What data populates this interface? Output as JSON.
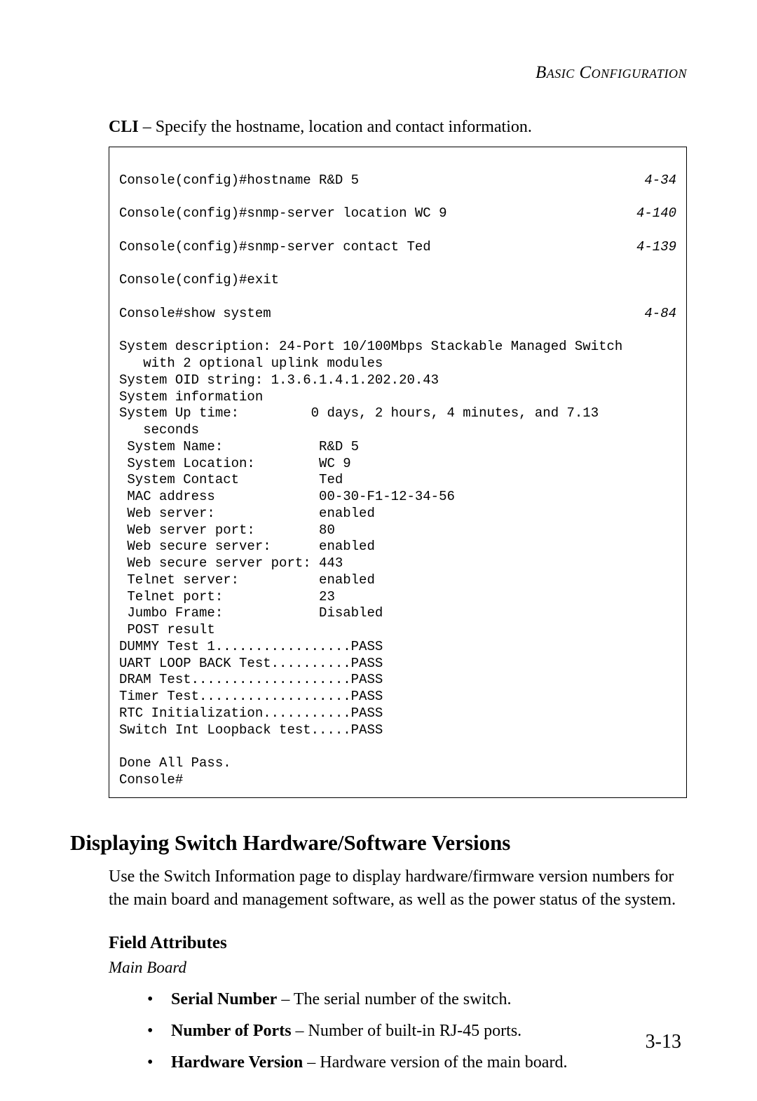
{
  "running_head": "Basic Configuration",
  "intro": {
    "label": "CLI",
    "text": " – Specify the hostname, location and contact information."
  },
  "cli": {
    "rows_with_ref": [
      {
        "cmd": "Console(config)#hostname R&D 5",
        "ref": "4-34"
      },
      {
        "cmd": "Console(config)#snmp-server location WC 9",
        "ref": "4-140"
      },
      {
        "cmd": "Console(config)#snmp-server contact Ted",
        "ref": "4-139"
      },
      {
        "cmd": "Console(config)#exit",
        "ref": ""
      },
      {
        "cmd": "Console#show system",
        "ref": "4-84"
      }
    ],
    "body": "System description: 24-Port 10/100Mbps Stackable Managed Switch \n   with 2 optional uplink modules\nSystem OID string: 1.3.6.1.4.1.202.20.43\nSystem information\nSystem Up time:         0 days, 2 hours, 4 minutes, and 7.13 \n   seconds\n System Name:            R&D 5\n System Location:        WC 9\n System Contact          Ted\n MAC address             00-30-F1-12-34-56\n Web server:             enabled\n Web server port:        80\n Web secure server:      enabled\n Web secure server port: 443\n Telnet server:          enabled\n Telnet port:            23\n Jumbo Frame:            Disabled\n POST result\nDUMMY Test 1.................PASS\nUART LOOP BACK Test..........PASS\nDRAM Test....................PASS\nTimer Test...................PASS\nRTC Initialization...........PASS\nSwitch Int Loopback test.....PASS\n\nDone All Pass.\nConsole#"
  },
  "section_heading": "Displaying Switch Hardware/Software Versions",
  "section_para": "Use the Switch Information page to display hardware/firmware version numbers for the main board and management software, as well as the power status of the system.",
  "field_attributes_heading": "Field Attributes",
  "main_board_label": "Main Board",
  "attrs": [
    {
      "term": "Serial Number",
      "desc": " – The serial number of the switch."
    },
    {
      "term": "Number of Ports",
      "desc": " – Number of built-in RJ-45 ports."
    },
    {
      "term": "Hardware Version",
      "desc": " – Hardware version of the main board."
    }
  ],
  "page_number": "3-13"
}
